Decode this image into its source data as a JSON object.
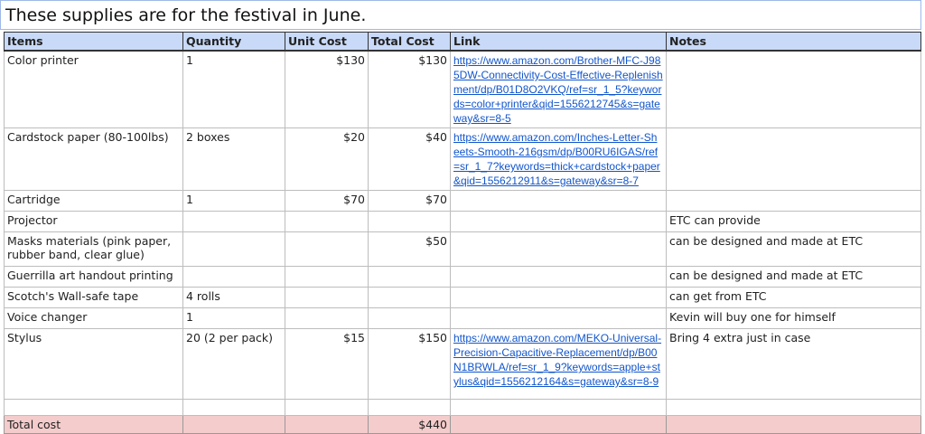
{
  "title": "These supplies are for the festival in June.",
  "headers": [
    "Items",
    "Quantity",
    "Unit Cost",
    "Total Cost",
    "Link",
    "Notes"
  ],
  "rows": [
    {
      "item": "Color printer",
      "quantity": "1",
      "unit_cost": "$130",
      "total_cost": "$130",
      "link": "https://www.amazon.com/Brother-MFC-J985DW-Connectivity-Cost-Effective-Replenishment/dp/B01D8O2VKQ/ref=sr_1_5?keywords=color+printer&qid=1556212745&s=gateway&sr=8-5",
      "notes": ""
    },
    {
      "item": "Cardstock paper (80-100lbs)",
      "quantity": "2 boxes",
      "unit_cost": "$20",
      "total_cost": "$40",
      "link": "https://www.amazon.com/Inches-Letter-Sheets-Smooth-216gsm/dp/B00RU6IGAS/ref=sr_1_7?keywords=thick+cardstock+paper&qid=1556212911&s=gateway&sr=8-7",
      "notes": ""
    },
    {
      "item": "Cartridge",
      "quantity": "1",
      "unit_cost": "$70",
      "total_cost": "$70",
      "link": "",
      "notes": ""
    },
    {
      "item": "Projector",
      "quantity": "",
      "unit_cost": "",
      "total_cost": "",
      "link": "",
      "notes": "ETC can provide"
    },
    {
      "item": "Masks materials (pink paper, rubber band, clear glue)",
      "quantity": "",
      "unit_cost": "",
      "total_cost": "$50",
      "link": "",
      "notes": "can be designed and made at ETC"
    },
    {
      "item": "Guerrilla art handout printing",
      "quantity": "",
      "unit_cost": "",
      "total_cost": "",
      "link": "",
      "notes": "can be designed and made at ETC"
    },
    {
      "item": "Scotch's Wall-safe tape",
      "quantity": "4 rolls",
      "unit_cost": "",
      "total_cost": "",
      "link": "",
      "notes": "can get from ETC"
    },
    {
      "item": "Voice changer",
      "quantity": "1",
      "unit_cost": "",
      "total_cost": "",
      "link": "",
      "notes": "Kevin will buy one for himself"
    },
    {
      "item": "Stylus",
      "quantity": "20 (2 per pack)",
      "unit_cost": "$15",
      "total_cost": "$150",
      "link": "https://www.amazon.com/MEKO-Universal-Precision-Capacitive-Replacement/dp/B00N1BRWLA/ref=sr_1_9?keywords=apple+stylus&qid=1556212164&s=gateway&sr=8-9",
      "notes": "Bring 4 extra just in case"
    }
  ],
  "total": {
    "label": "Total cost",
    "value": "$440"
  },
  "colors": {
    "header_bg": "#c9daf8",
    "total_bg": "#f4cccc",
    "link": "#1155cc"
  }
}
